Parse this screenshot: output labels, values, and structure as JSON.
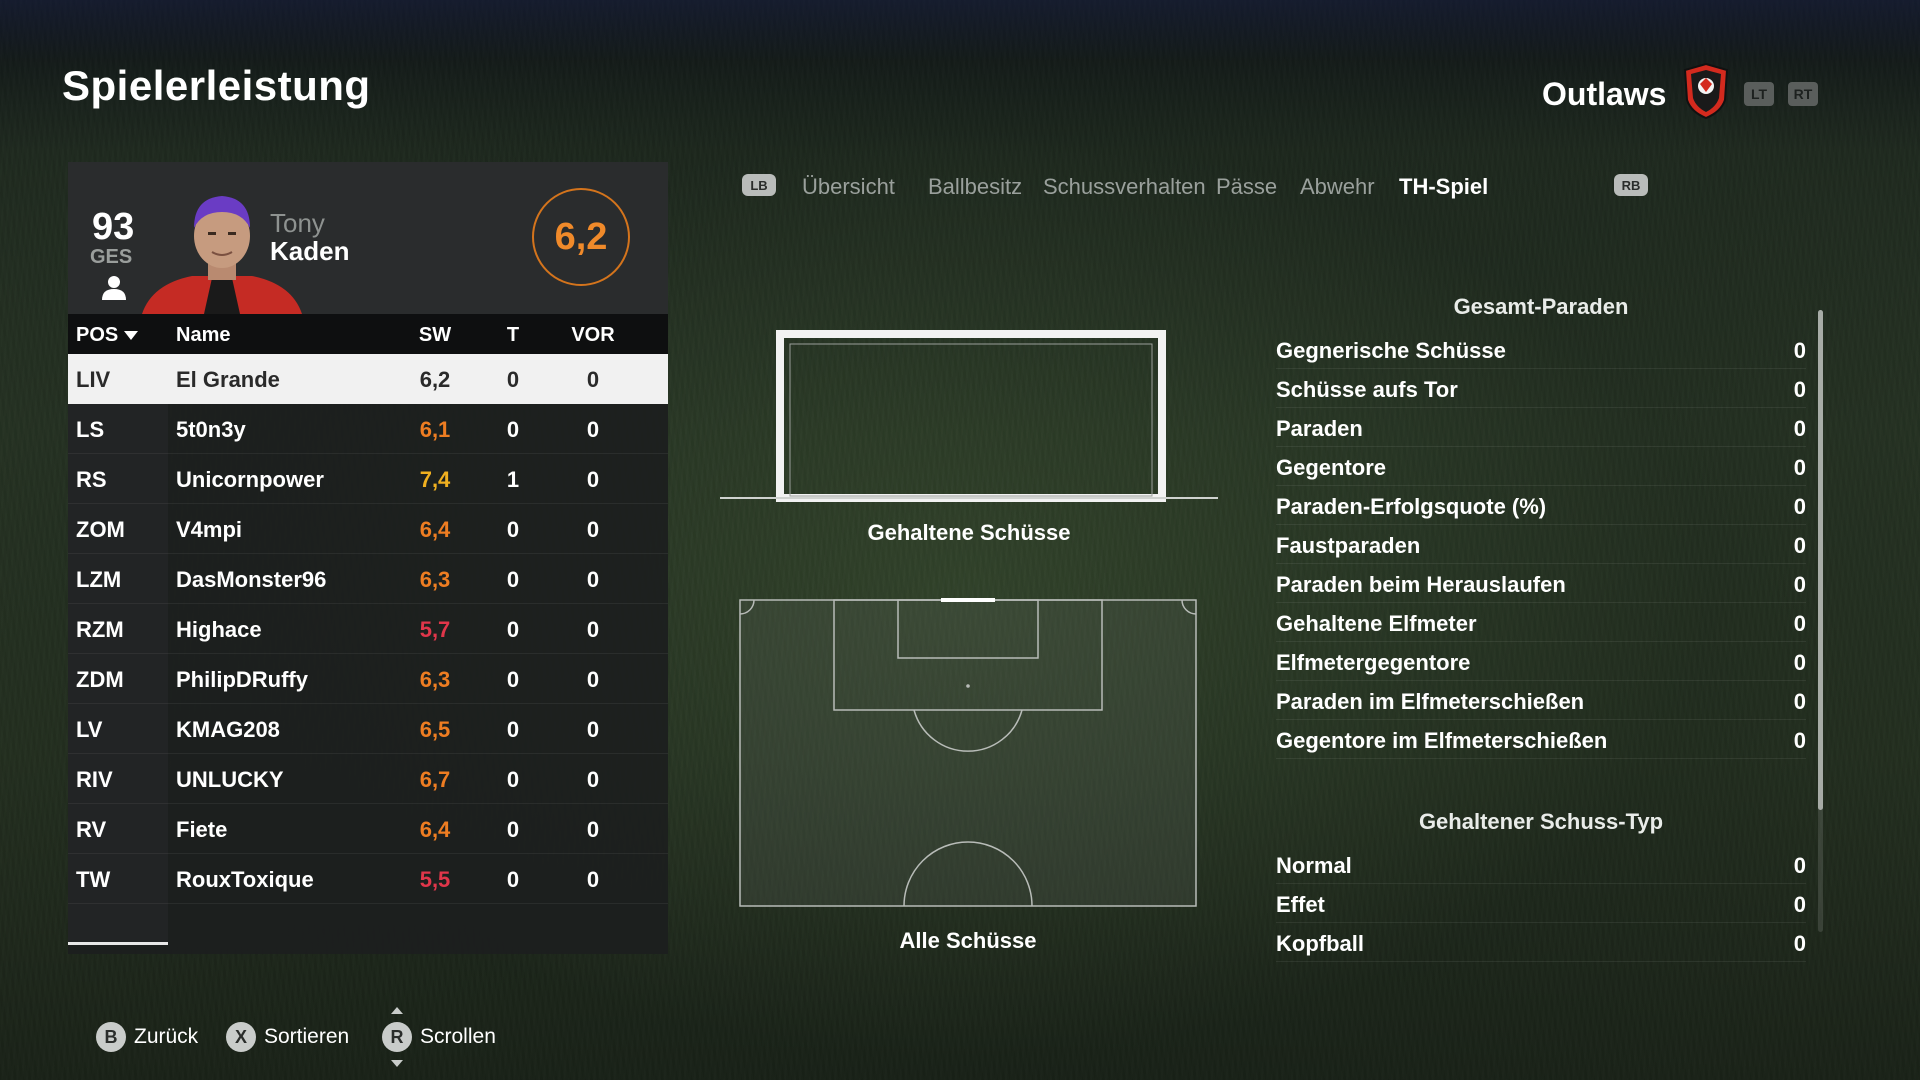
{
  "page": {
    "title": "Spielerleistung"
  },
  "team": {
    "name": "Outlaws",
    "lt_label": "LT",
    "rt_label": "RT"
  },
  "player_card": {
    "overall": "93",
    "overall_label": "GES",
    "first_name": "Tony",
    "last_name": "Kaden",
    "match_rating": "6,2"
  },
  "table": {
    "headers": {
      "pos": "POS",
      "name": "Name",
      "sw": "SW",
      "t": "T",
      "vor": "VOR"
    },
    "rows": [
      {
        "pos": "LIV",
        "name": "El Grande",
        "sw": "6,2",
        "t": "0",
        "vor": "0",
        "sw_color": "#2a2a2a"
      },
      {
        "pos": "LS",
        "name": "5t0n3y",
        "sw": "6,1",
        "t": "0",
        "vor": "0",
        "sw_color": "#ee7d22"
      },
      {
        "pos": "RS",
        "name": "Unicornpower",
        "sw": "7,4",
        "t": "1",
        "vor": "0",
        "sw_color": "#f0b020"
      },
      {
        "pos": "ZOM",
        "name": "V4mpi",
        "sw": "6,4",
        "t": "0",
        "vor": "0",
        "sw_color": "#ee7d22"
      },
      {
        "pos": "LZM",
        "name": "DasMonster96",
        "sw": "6,3",
        "t": "0",
        "vor": "0",
        "sw_color": "#ee7d22"
      },
      {
        "pos": "RZM",
        "name": "Highace",
        "sw": "5,7",
        "t": "0",
        "vor": "0",
        "sw_color": "#e0364a"
      },
      {
        "pos": "ZDM",
        "name": "PhilipDRuffy",
        "sw": "6,3",
        "t": "0",
        "vor": "0",
        "sw_color": "#ee7d22"
      },
      {
        "pos": "LV",
        "name": "KMAG208",
        "sw": "6,5",
        "t": "0",
        "vor": "0",
        "sw_color": "#ee7d22"
      },
      {
        "pos": "RIV",
        "name": "UNLUCKY",
        "sw": "6,7",
        "t": "0",
        "vor": "0",
        "sw_color": "#ee7d22"
      },
      {
        "pos": "RV",
        "name": "Fiete",
        "sw": "6,4",
        "t": "0",
        "vor": "0",
        "sw_color": "#ee7d22"
      },
      {
        "pos": "TW",
        "name": "RouxToxique",
        "sw": "5,5",
        "t": "0",
        "vor": "0",
        "sw_color": "#e0364a"
      }
    ]
  },
  "tabs": {
    "lb": "LB",
    "rb": "RB",
    "items": [
      "Übersicht",
      "Ballbesitz",
      "Schussverhalten",
      "Pässe",
      "Abwehr",
      "TH-Spiel"
    ],
    "active_index": 5
  },
  "visuals": {
    "goal_caption": "Gehaltene Schüsse",
    "pitch_caption": "Alle Schüsse"
  },
  "stats": {
    "section1_title": "Gesamt-Paraden",
    "section1": [
      {
        "label": "Gegnerische Schüsse",
        "value": "0"
      },
      {
        "label": "Schüsse aufs Tor",
        "value": "0"
      },
      {
        "label": "Paraden",
        "value": "0"
      },
      {
        "label": "Gegentore",
        "value": "0"
      },
      {
        "label": "Paraden-Erfolgsquote (%)",
        "value": "0"
      },
      {
        "label": "Faustparaden",
        "value": "0"
      },
      {
        "label": "Paraden beim Herauslaufen",
        "value": "0"
      },
      {
        "label": "Gehaltene Elfmeter",
        "value": "0"
      },
      {
        "label": "Elfmetergegentore",
        "value": "0"
      },
      {
        "label": "Paraden im Elfmeterschießen",
        "value": "0"
      },
      {
        "label": "Gegentore im Elfmeterschießen",
        "value": "0"
      }
    ],
    "section2_title": "Gehaltener Schuss-Typ",
    "section2": [
      {
        "label": "Normal",
        "value": "0"
      },
      {
        "label": "Effet",
        "value": "0"
      },
      {
        "label": "Kopfball",
        "value": "0"
      }
    ]
  },
  "footer": {
    "back_btn": "B",
    "back_label": "Zurück",
    "sort_btn": "X",
    "sort_label": "Sortieren",
    "scroll_btn": "R",
    "scroll_label": "Scrollen"
  },
  "colors": {
    "accent": "#ee7d22",
    "low_rating": "#e0364a",
    "high_rating": "#f0b020"
  }
}
